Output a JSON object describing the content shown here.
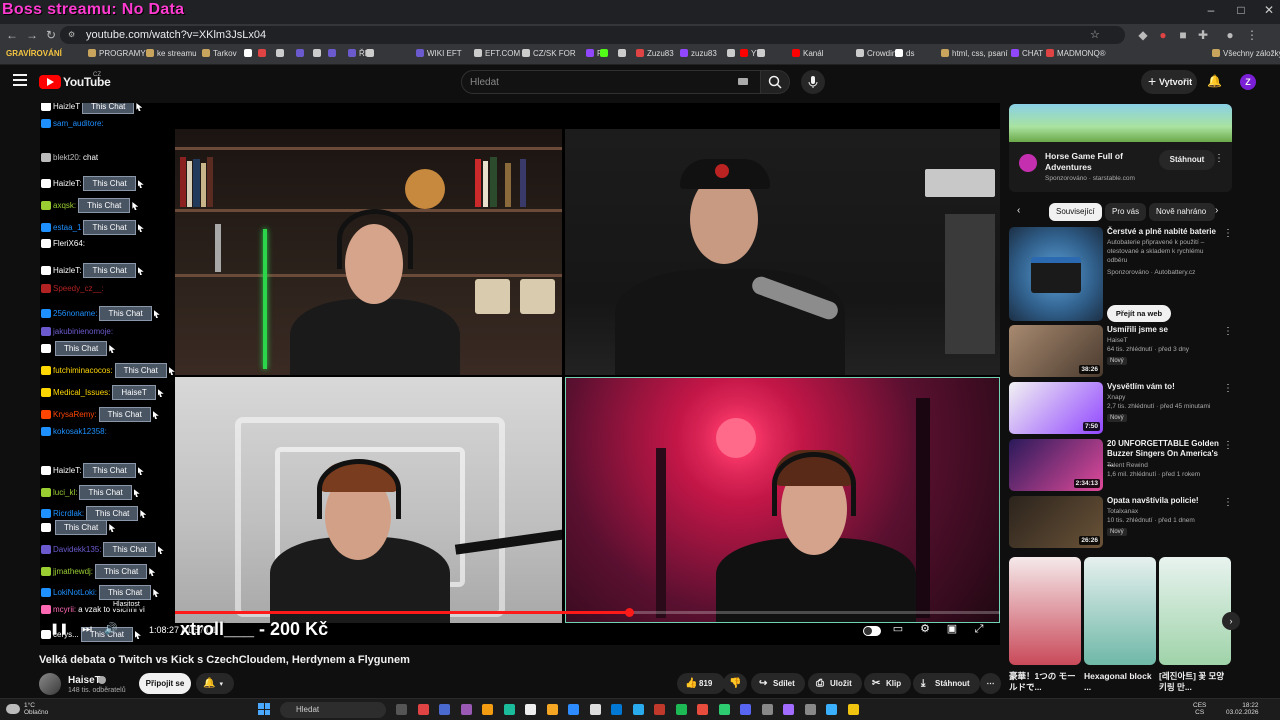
{
  "overlay": {
    "title": "Boss streamu: No Data"
  },
  "browser": {
    "url": "youtube.com/watch?v=XKlm3JsLx04",
    "profile_label": "GRAVÍROVÁNÍ",
    "bookmarks": [
      {
        "label": "PROGRAMY",
        "color": "#c9a45c"
      },
      {
        "label": "ke streamu",
        "color": "#c9a45c"
      },
      {
        "label": "Tarkov",
        "color": "#c9a45c"
      },
      {
        "label": "",
        "color": "#ffffff"
      },
      {
        "label": "",
        "color": "#e04343"
      },
      {
        "label": "",
        "color": "#cccccc"
      },
      {
        "label": "",
        "color": "#6a5acd"
      },
      {
        "label": "",
        "color": "#cccccc"
      },
      {
        "label": "",
        "color": "#6a5acd"
      },
      {
        "label": "ŘP",
        "color": "#6a5acd"
      },
      {
        "label": "",
        "color": "#cccccc"
      },
      {
        "label": "WIKI EFT",
        "color": "#6a5acd"
      },
      {
        "label": "EFT.COM",
        "color": "#cccccc"
      },
      {
        "label": "CZ/SK FOR",
        "color": "#cccccc"
      },
      {
        "label": "F",
        "color": "#9146ff"
      },
      {
        "label": "",
        "color": "#53fc18"
      },
      {
        "label": "",
        "color": "#cccccc"
      },
      {
        "label": "Zuzu83",
        "color": "#e04343"
      },
      {
        "label": "zuzu83",
        "color": "#9146ff"
      },
      {
        "label": "",
        "color": "#cccccc"
      },
      {
        "label": "YT",
        "color": "#ff0000"
      },
      {
        "label": "",
        "color": "#cccccc"
      },
      {
        "label": "Kanál",
        "color": "#ff0000"
      },
      {
        "label": "Crowdin",
        "color": "#cccccc"
      },
      {
        "label": "ds",
        "color": "#ffffff"
      },
      {
        "label": "html, css, psaní",
        "color": "#c9a45c"
      },
      {
        "label": "CHAT",
        "color": "#9146ff"
      },
      {
        "label": "MADMONQ®",
        "color": "#e04343"
      }
    ],
    "all_bookmarks": "Všechny záložky",
    "window_buttons": [
      "–",
      "□",
      "✕"
    ]
  },
  "youtube": {
    "logo_text": "YouTube",
    "region": "CZ",
    "search_placeholder": "Hledat",
    "create_label": "Vytvořit",
    "avatar_letter": "Z"
  },
  "player": {
    "chat": [
      {
        "user": "HaizleT",
        "tag": "This Chat",
        "color": "#ffffff"
      },
      {
        "user": "sam_auditore:",
        "tag": "",
        "color": "#1e90ff"
      },
      {
        "user": "blekt20:",
        "tag": "",
        "color": "#bbbbbb",
        "msg": "chat"
      },
      {
        "user": "HaizleT:",
        "tag": "This Chat",
        "color": "#ffffff"
      },
      {
        "user": "axqsk:",
        "tag": "This Chat",
        "color": "#9acd32"
      },
      {
        "user": "estaa_1",
        "tag": "This Chat",
        "color": "#1e90ff"
      },
      {
        "user": "FleriX64:",
        "tag": "",
        "color": "#ffffff"
      },
      {
        "user": "HaizleT:",
        "tag": "This Chat",
        "color": "#ffffff"
      },
      {
        "user": "Speedy_cz__:",
        "tag": "",
        "color": "#b22222"
      },
      {
        "user": "256noname:",
        "tag": "This Chat",
        "color": "#1e90ff"
      },
      {
        "user": "jakubinienomoje:",
        "tag": "",
        "color": "#6a5acd"
      },
      {
        "user": "",
        "tag": "This Chat",
        "color": "#ffffff"
      },
      {
        "user": "futchiminacocos:",
        "tag": "This Chat",
        "color": "#ffd700"
      },
      {
        "user": "Medical_Issues:",
        "tag": "HaiseT",
        "color": "#ffd700"
      },
      {
        "user": "KrysaRemy:",
        "tag": "This Chat",
        "color": "#ff4500"
      },
      {
        "user": "kokosak12358:",
        "tag": "",
        "color": "#1e90ff"
      },
      {
        "user": "HaizleT:",
        "tag": "This Chat",
        "color": "#ffffff"
      },
      {
        "user": "luci_kl:",
        "tag": "This Chat",
        "color": "#9acd32"
      },
      {
        "user": "Ricrdlak:",
        "tag": "This Chat",
        "color": "#1e90ff"
      },
      {
        "user": "",
        "tag": "This Chat",
        "color": "#ffffff"
      },
      {
        "user": "Davidekk135:",
        "tag": "This Chat",
        "color": "#6a5acd"
      },
      {
        "user": "jjmathewdj:",
        "tag": "This Chat",
        "color": "#9acd32"
      },
      {
        "user": "LokiNotLoki:",
        "tag": "This Chat",
        "color": "#1e90ff"
      },
      {
        "user": "mcyrii:",
        "tag": "",
        "color": "#ff69b4",
        "msg": "a vzak to vsichni vi"
      },
      {
        "user": "cerys...",
        "tag": "This Chat",
        "color": "#ffffff"
      }
    ],
    "volume_tooltip": "Hlasitost",
    "timecode": "1:08:27 / 1:57:01",
    "donation_text": "xtroll___ - 200 Kč",
    "progress": 0.55
  },
  "video": {
    "title": "Velká debata o Twitch vs Kick s CzechCloudem, Herdynem a Flygunem",
    "channel": "HaiseT",
    "subscribers": "148 tis. odběratelů",
    "subscribe_label": "Připojit se",
    "likes": "819",
    "share_label": "Sdílet",
    "save_label": "Uložit",
    "clip_label": "Klip",
    "download_label": "Stáhnout"
  },
  "sidebar": {
    "ad": {
      "title": "Horse Game Full of Adventures",
      "sponsor": "Sponzorováno · starstable.com",
      "button": "Stáhnout"
    },
    "chips": [
      "Související",
      "Pro vás",
      "Nově nahráno"
    ],
    "ad2": {
      "title": "Čerstvé a plně nabité baterie",
      "desc": "Autobaterie připravené k použití – otestované a skladem k rychlému odběru",
      "sponsor": "Sponzorováno · Autobattery.cz",
      "button": "Přejít na web"
    },
    "videos": [
      {
        "title": "Usmířili jsme se",
        "channel": "HaiseT",
        "meta": "64 tis. zhlédnutí · před 3 dny",
        "duration": "38:26",
        "badge": "Nový"
      },
      {
        "title": "Vysvětlím vám to!",
        "channel": "Xnapy",
        "meta": "2,7 tis. zhlédnutí · před 45 minutami",
        "duration": "7:50",
        "badge": "Nový"
      },
      {
        "title": "20 UNFORGETTABLE Golden Buzzer Singers On America's ...",
        "channel": "Talent Rewind",
        "meta": "1,6 mil. zhlédnutí · před 1 rokem",
        "duration": "2:34:13",
        "badge": ""
      },
      {
        "title": "Opata navštívila policie!",
        "channel": "Totalxanax",
        "meta": "10 tis. zhlédnutí · před 1 dnem",
        "duration": "26:26",
        "badge": "Nový"
      }
    ],
    "shorts": [
      {
        "title": "豪華！1つの モールドで..."
      },
      {
        "title": "Hexagonal block ..."
      },
      {
        "title": "[레진아트] 꽃 모양 키링 만..."
      }
    ]
  },
  "taskbar": {
    "weather_temp": "1°C",
    "weather_desc": "Oblačno",
    "search": "Hledat",
    "lang_top": "CES",
    "lang_bottom": "CS",
    "time": "18:22",
    "date": "03.02.2026"
  }
}
